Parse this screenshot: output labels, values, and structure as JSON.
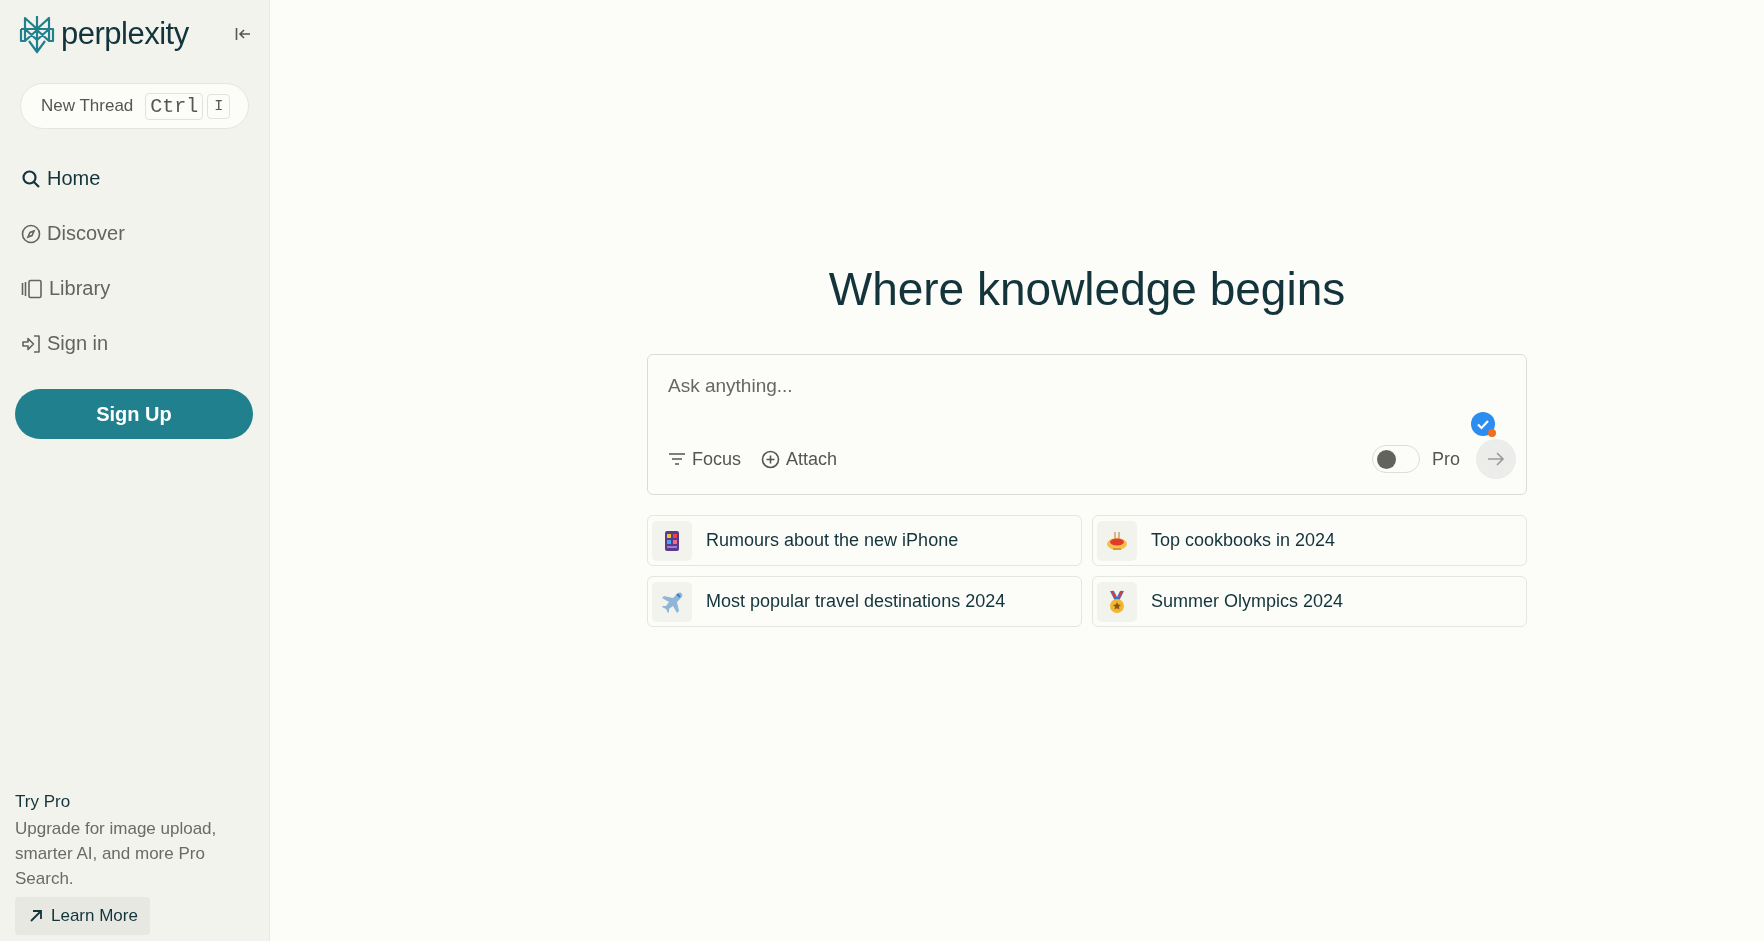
{
  "sidebar": {
    "logo_text": "perplexity",
    "new_thread": {
      "label": "New Thread",
      "keys": [
        "Ctrl",
        "I"
      ]
    },
    "items": [
      {
        "label": "Home",
        "kind": "search",
        "selected": true
      },
      {
        "label": "Discover",
        "kind": "compass",
        "selected": false
      },
      {
        "label": "Library",
        "kind": "library",
        "selected": false
      },
      {
        "label": "Sign in",
        "kind": "signin",
        "selected": false
      }
    ],
    "signup": "Sign Up",
    "promo": {
      "title": "Try Pro",
      "text": "Upgrade for image upload, smarter AI, and more Pro Search.",
      "button": "Learn More"
    }
  },
  "main": {
    "heading": "Where knowledge begins",
    "search": {
      "placeholder": "Ask anything...",
      "focus": "Focus",
      "attach": "Attach",
      "pro": {
        "label": "Pro",
        "on": false
      }
    },
    "suggestions": [
      {
        "text": "Rumours about the new iPhone",
        "kind": "phone"
      },
      {
        "text": "Top cookbooks in 2024",
        "kind": "bowl"
      },
      {
        "text": "Most popular travel destinations 2024",
        "kind": "plane"
      },
      {
        "text": "Summer Olympics 2024",
        "kind": "medal"
      }
    ]
  }
}
